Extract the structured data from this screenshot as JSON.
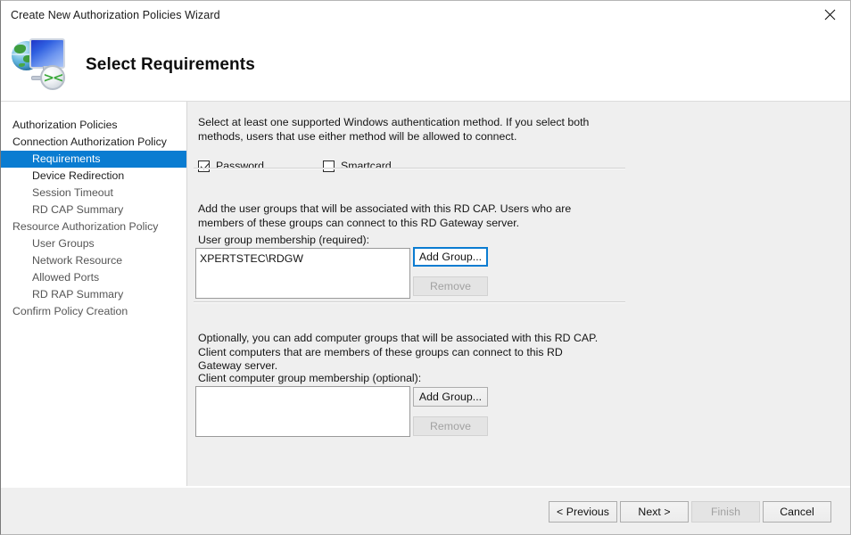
{
  "window": {
    "title": "Create New Authorization Policies Wizard",
    "close_icon": "close-icon"
  },
  "header": {
    "title": "Select Requirements",
    "icon": "rd-gateway-wizard-icon",
    "badge_glyph": "><"
  },
  "sidebar": {
    "items": [
      {
        "label": "Authorization Policies",
        "level": 0,
        "state": "normal"
      },
      {
        "label": "Connection Authorization Policy",
        "level": 0,
        "state": "normal"
      },
      {
        "label": "Requirements",
        "level": 1,
        "state": "selected"
      },
      {
        "label": "Device Redirection",
        "level": 1,
        "state": "normal"
      },
      {
        "label": "Session Timeout",
        "level": 1,
        "state": "muted"
      },
      {
        "label": "RD CAP Summary",
        "level": 1,
        "state": "muted"
      },
      {
        "label": "Resource Authorization Policy",
        "level": 0,
        "state": "muted"
      },
      {
        "label": "User Groups",
        "level": 1,
        "state": "muted"
      },
      {
        "label": "Network Resource",
        "level": 1,
        "state": "muted"
      },
      {
        "label": "Allowed Ports",
        "level": 1,
        "state": "muted"
      },
      {
        "label": "RD RAP Summary",
        "level": 1,
        "state": "muted"
      },
      {
        "label": "Confirm Policy Creation",
        "level": 0,
        "state": "muted"
      }
    ]
  },
  "content": {
    "auth_description": "Select at least one supported Windows authentication method. If you select both methods, users that use either method will be allowed to connect.",
    "checkbox_password": {
      "label": "Password",
      "checked": true
    },
    "checkbox_smartcard": {
      "label": "Smartcard",
      "checked": false
    },
    "user_group_description": "Add the user groups that will be associated with this RD CAP. Users who are members of these groups can connect to this RD Gateway server.",
    "user_group_label": "User group membership (required):",
    "user_group_items": [
      "XPERTSTEC\\RDGW"
    ],
    "user_group_add_button": "Add Group...",
    "user_group_remove_button": "Remove",
    "computer_group_description": "Optionally, you can add computer groups that will be associated with this RD CAP. Client computers that are members of these groups can connect to this RD Gateway server.",
    "computer_group_label": "Client computer group membership (optional):",
    "computer_group_items": [],
    "computer_group_add_button": "Add Group...",
    "computer_group_remove_button": "Remove"
  },
  "footer": {
    "previous_button": "< Previous",
    "next_button": "Next >",
    "finish_button": "Finish",
    "cancel_button": "Cancel"
  },
  "colors": {
    "accent_blue": "#0a7cd1",
    "content_bg": "#efefef",
    "sidebar_bg": "#ffffff"
  }
}
